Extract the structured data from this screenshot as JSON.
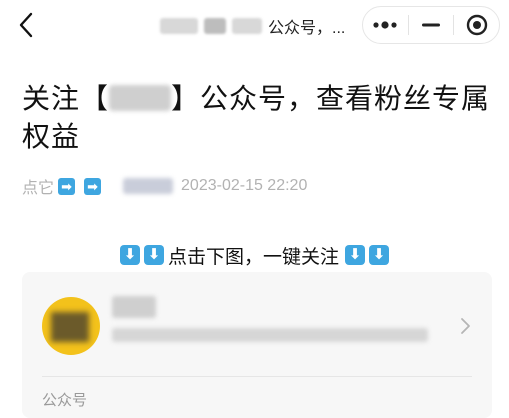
{
  "nav": {
    "title_suffix": "公众号，...",
    "back_icon": "chevron-left-icon",
    "menu_icons": [
      "more-dots-icon",
      "minimize-icon",
      "close-target-icon"
    ]
  },
  "article": {
    "title_prefix": "关注【",
    "title_suffix": "】公众号，查看粉丝专属权益",
    "meta_prefix": "点它",
    "meta_arrows": [
      "➡",
      "➡"
    ],
    "date": "2023-02-15 22:20"
  },
  "prompt": {
    "arrows_left": [
      "⬇",
      "⬇"
    ],
    "text": "点击下图，一键关注",
    "arrows_right": [
      "⬇",
      "⬇"
    ]
  },
  "card": {
    "type_label": "公众号",
    "chevron_icon": "chevron-right-icon"
  },
  "colors": {
    "accent_blue": "#3ea6e0",
    "avatar_yellow": "#f3c21b",
    "muted_text": "#b2b2b2",
    "card_bg": "#f7f7f7"
  }
}
